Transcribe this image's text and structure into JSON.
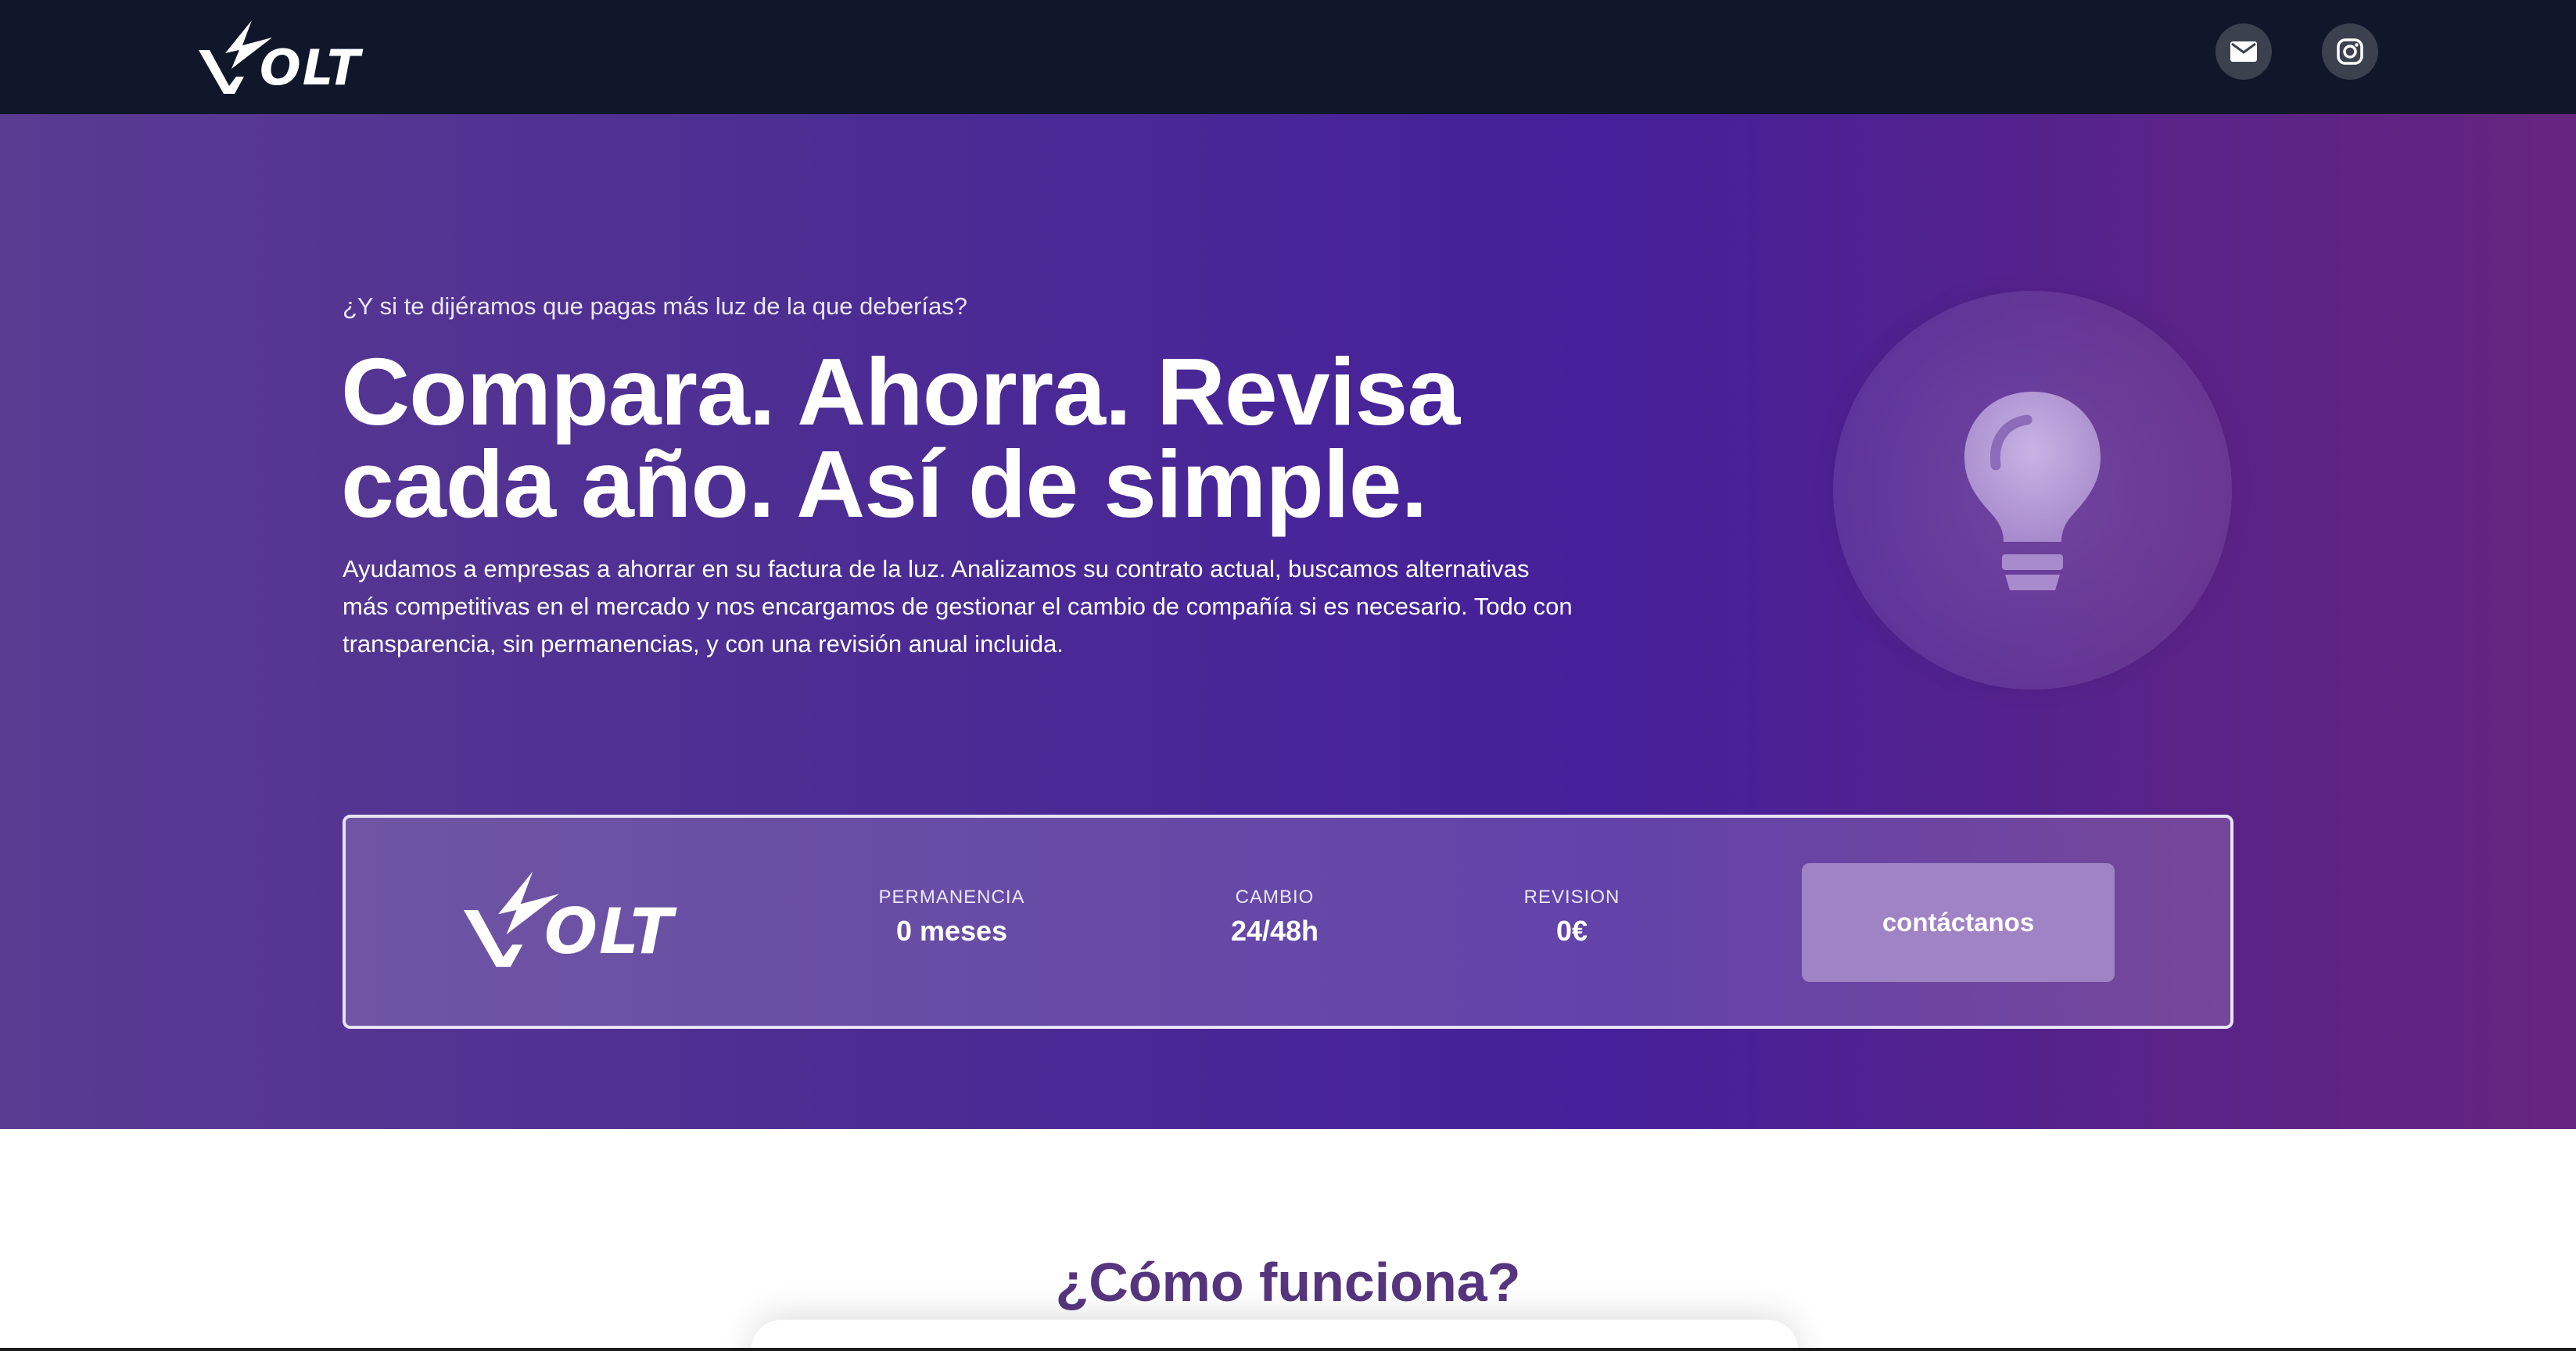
{
  "header": {
    "logo_text": "OLT",
    "mail_icon": "mail-icon",
    "instagram_icon": "instagram-icon"
  },
  "hero": {
    "kicker": "¿Y si te dijéramos que pagas más luz de la que deberías?",
    "headline": "Compara. Ahorra. Revisa cada año. Así de simple.",
    "lead": "Ayudamos a empresas a ahorrar en su factura de la luz. Analizamos su contrato actual, buscamos alternativas más competitivas en el mercado y nos encargamos de gestionar el cambio de compañía si es necesario. Todo con transparencia, sin permanencias, y con una revisión anual incluida.",
    "illustration_icon": "lightbulb-icon"
  },
  "stats": {
    "logo_text": "OLT",
    "items": [
      {
        "label": "PERMANENCIA",
        "value": "0 meses"
      },
      {
        "label": "CAMBIO",
        "value": "24/48h"
      },
      {
        "label": "REVISION",
        "value": "0€"
      }
    ],
    "cta_label": "contáctanos"
  },
  "section": {
    "title": "¿Cómo funciona?"
  },
  "colors": {
    "topbar": "#11172a",
    "hero_start": "#5a3b92",
    "hero_mid": "#45209a",
    "hero_end": "#66257f",
    "cta": "#a083c4",
    "section_title": "#56357e"
  }
}
